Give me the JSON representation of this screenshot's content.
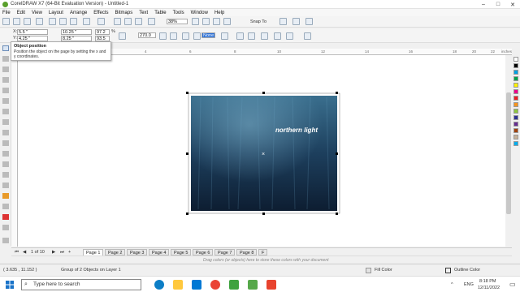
{
  "window": {
    "title": "CorelDRAW X7 (64-Bit Evaluation Version) - Untitled-1"
  },
  "menu": [
    "File",
    "Edit",
    "View",
    "Layout",
    "Arrange",
    "Effects",
    "Bitmaps",
    "Text",
    "Table",
    "Tools",
    "Window",
    "Help"
  ],
  "toolbar": {
    "zoom": "38%",
    "snap_to": "Snap To"
  },
  "property_bar": {
    "x": "5.5 \"",
    "y": "4.25 \"",
    "width": "10.25 \"",
    "height": "8.25 \"",
    "scale_x": "97.2",
    "scale_y": "93.5",
    "percent": "%",
    "rotation": "270.0",
    "outline": "None"
  },
  "tooltip": {
    "title": "Object position",
    "body": "Position the object on the page by setting the x and y coordinates."
  },
  "ruler": {
    "unit": "inches",
    "ticks": [
      "2",
      "0",
      "2",
      "4",
      "6",
      "8",
      "10",
      "12",
      "14",
      "16",
      "18",
      "20",
      "22"
    ]
  },
  "artwork": {
    "text": "northern light"
  },
  "pages": {
    "counter": "1 of 10",
    "tabs": [
      "Page 1",
      "Page 2",
      "Page 3",
      "Page 4",
      "Page 5",
      "Page 6",
      "Page 7",
      "Page 8",
      "F"
    ]
  },
  "hint": "Drag colors (or objects) here to store these colors with your document",
  "status": {
    "coords": "( 3.635 , 11.152 )",
    "selection": "Group of 2 Objects on Layer 1",
    "fill": "Fill Color",
    "outline": "Outline Color"
  },
  "taskbar": {
    "search_placeholder": "Type here to search",
    "lang": "ENG",
    "time": "8:18 PM",
    "date": "12/11/2022"
  },
  "palette_colors": [
    "#ffffff",
    "#000000",
    "#00a0e3",
    "#00a14b",
    "#fff200",
    "#ec008c",
    "#ed1c24",
    "#f7941d",
    "#8dc63f",
    "#2e3192",
    "#662d91",
    "#a0410d",
    "#c7b299",
    "#00aeef"
  ]
}
